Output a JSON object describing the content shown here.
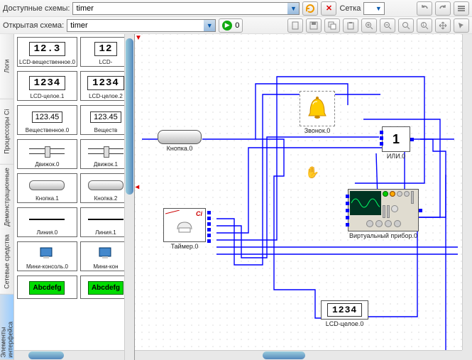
{
  "toolbar1": {
    "available_label": "Доступные схемы:",
    "available_value": "timer",
    "grid_label": "Сетка"
  },
  "toolbar2": {
    "open_label": "Открытая схема:",
    "open_value": "timer",
    "counter": "0"
  },
  "vtabs": [
    {
      "label": "Логи",
      "active": false
    },
    {
      "label": "Процессоры Ci",
      "active": false
    },
    {
      "label": "Демонстрационные",
      "active": false
    },
    {
      "label": "Сетевые средства",
      "active": false
    },
    {
      "label": "Элементы интерфейса",
      "active": true
    }
  ],
  "palette": [
    {
      "kind": "lcd",
      "text": "12.3",
      "label": "LCD-вещественное.0"
    },
    {
      "kind": "lcd",
      "text": "12",
      "label": "LCD-"
    },
    {
      "kind": "lcd",
      "text": "1234",
      "label": "LCD-целое.1"
    },
    {
      "kind": "lcd",
      "text": "1234",
      "label": "LCD-целое.2"
    },
    {
      "kind": "field",
      "text": "123.45",
      "label": "Вещественное.0"
    },
    {
      "kind": "field",
      "text": "123.45",
      "label": "Веществ"
    },
    {
      "kind": "slider",
      "label": "Движок.0"
    },
    {
      "kind": "slider",
      "label": "Движок.1"
    },
    {
      "kind": "button",
      "label": "Кнопка.1"
    },
    {
      "kind": "button",
      "label": "Кнопка.2"
    },
    {
      "kind": "line",
      "label": "Линия.0"
    },
    {
      "kind": "line",
      "label": "Линия.1"
    },
    {
      "kind": "console",
      "label": "Мини-консоль.0"
    },
    {
      "kind": "console",
      "label": "Мини-кон"
    },
    {
      "kind": "green",
      "text": "Abcdefg",
      "label": ""
    },
    {
      "kind": "green",
      "text": "Abcdefg",
      "label": ""
    }
  ],
  "canvas": {
    "nodes": {
      "knopka": {
        "label": "Кнопка.0"
      },
      "timer": {
        "label": "Таймер.0",
        "badge": "Ci"
      },
      "bell": {
        "label": "Звонок.0"
      },
      "or": {
        "text": "1",
        "label": "ИЛИ.0"
      },
      "scope": {
        "label": "Виртуальный прибор.0"
      },
      "lcd": {
        "text": "1234",
        "label": "LCD-целое.0"
      }
    }
  }
}
